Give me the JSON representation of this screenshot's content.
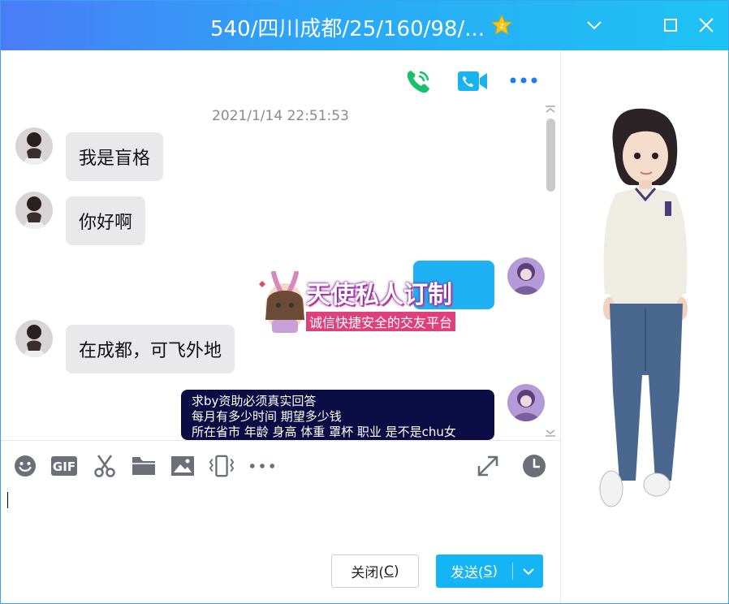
{
  "window": {
    "title": "540/四川成都/25/160/98/...",
    "controls": [
      "chevron-down-icon",
      "maximize-icon",
      "close-icon"
    ]
  },
  "chat_header": {
    "icons": [
      "voice-call-icon",
      "video-call-icon",
      "more-icon"
    ]
  },
  "messages": {
    "timestamp": "2021/1/14 22:51:53",
    "m1": {
      "side": "left",
      "text": "我是盲格"
    },
    "m2": {
      "side": "left",
      "text": "你好啊"
    },
    "m3": {
      "side": "right",
      "kind": "sticker",
      "sticker_title": "天使私人订制",
      "sticker_subtitle": "诚信快捷安全的交友平台"
    },
    "m4": {
      "side": "left",
      "text": "在成都，可飞外地"
    },
    "m5": {
      "side": "right",
      "lines": [
        "求by资助必须真实回答",
        "每月有多少时间 期望多少钱",
        "所在省市 年龄 身高 体重 罩杯 职业 是不是chu女"
      ]
    }
  },
  "toolbar": {
    "items": [
      "emoji-icon",
      "gif-icon",
      "screenshot-scissors-icon",
      "folder-icon",
      "image-icon",
      "shake-window-icon",
      "more-tools-icon",
      "expand-icon",
      "history-clock-icon"
    ]
  },
  "input": {
    "value": ""
  },
  "actions": {
    "close_label": "关闭(",
    "close_key": "C",
    "close_tail": ")",
    "send_label": "发送(",
    "send_key": "S",
    "send_tail": ")"
  },
  "colors": {
    "title_gradient_start": "#4a7cf7",
    "title_gradient_end": "#1ec3f4",
    "send_button": "#14b4f5",
    "bubble_gray": "#e9e9ec",
    "bubble_dark": "#0c0c45",
    "call_green": "#19c06b",
    "video_blue": "#18b4f0"
  }
}
